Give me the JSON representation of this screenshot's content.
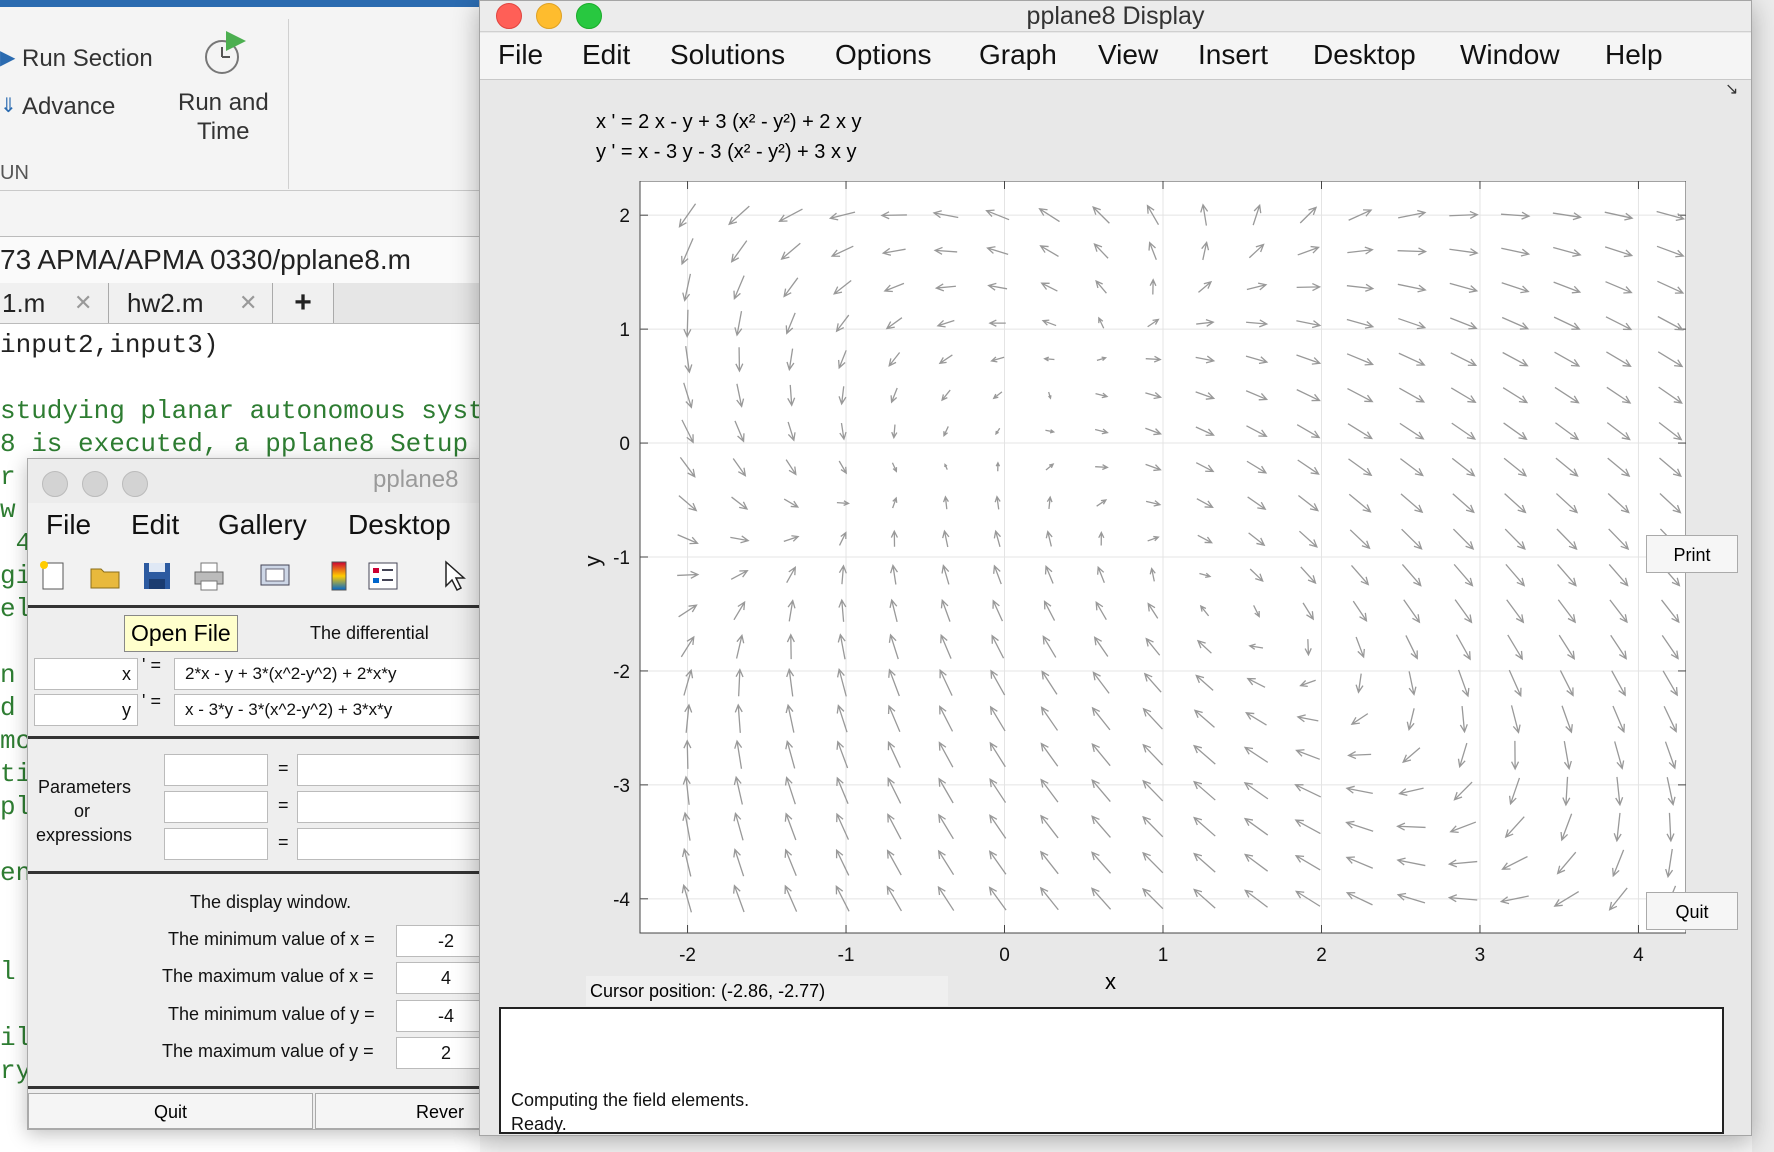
{
  "matlab": {
    "toolstrip": {
      "run_section": "Run Section",
      "advance": "Advance",
      "run_and_time_line1": "Run and",
      "run_and_time_line2": "Time",
      "group_label": "UN"
    },
    "path": "73 APMA/APMA 0330/pplane8.m",
    "tabs": [
      "1.m",
      "hw2.m"
    ],
    "new_tab": "+",
    "code_lines": [
      {
        "text": "input2,input3)",
        "color": "#222222"
      },
      {
        "text": "",
        "color": "#222222"
      },
      {
        "text": "studying planar autonomous syst",
        "color": "#2e7d32"
      },
      {
        "text": "8 is executed, a pplane8 Setup",
        "color": "#2e7d32"
      },
      {
        "text": "r",
        "color": "#2e7d32"
      },
      {
        "text": "w",
        "color": "#2e7d32"
      },
      {
        "text": " 4",
        "color": "#2e7d32"
      },
      {
        "text": "gi",
        "color": "#2e7d32"
      },
      {
        "text": "el",
        "color": "#2e7d32"
      },
      {
        "text": "",
        "color": "#2e7d32"
      },
      {
        "text": "n",
        "color": "#2e7d32"
      },
      {
        "text": "d",
        "color": "#2e7d32"
      },
      {
        "text": "mo",
        "color": "#2e7d32"
      },
      {
        "text": "ti",
        "color": "#2e7d32"
      },
      {
        "text": "pl",
        "color": "#2e7d32"
      },
      {
        "text": "",
        "color": "#2e7d32"
      },
      {
        "text": "en",
        "color": "#2e7d32"
      },
      {
        "text": "",
        "color": "#2e7d32"
      },
      {
        "text": "",
        "color": "#2e7d32"
      },
      {
        "text": "l",
        "color": "#2e7d32"
      },
      {
        "text": "",
        "color": "#2e7d32"
      },
      {
        "text": "il",
        "color": "#2e7d32"
      },
      {
        "text": "ry",
        "color": "#2e7d32"
      }
    ]
  },
  "setup": {
    "title": "pplane8",
    "menu": [
      "File",
      "Edit",
      "Gallery",
      "Desktop"
    ],
    "toolbar_icons": [
      "new-file-icon",
      "open-folder-icon",
      "save-icon",
      "print-icon",
      "print-preview-icon",
      "colorbar-icon",
      "legend-icon",
      "pointer-icon"
    ],
    "tooltip": "Open File",
    "differential_label": "The differential",
    "eq1": {
      "var": "x",
      "prime": "' =",
      "rhs": "2*x - y + 3*(x^2-y^2) + 2*x*y"
    },
    "eq2": {
      "var": "y",
      "prime": "' =",
      "rhs": "x - 3*y - 3*(x^2-y^2) + 3*x*y"
    },
    "parameters_label_1": "Parameters",
    "parameters_label_2": "or",
    "parameters_label_3": "expressions",
    "equals": "=",
    "display_window_label": "The display window.",
    "bounds": [
      {
        "label": "The minimum value of x =",
        "value": "-2"
      },
      {
        "label": "The maximum value of x =",
        "value": "4"
      },
      {
        "label": "The minimum value of y =",
        "value": "-4"
      },
      {
        "label": "The maximum value of y =",
        "value": "2"
      }
    ],
    "quit": "Quit",
    "revert": "Rever"
  },
  "display": {
    "title": "pplane8 Display",
    "menu": [
      "File",
      "Edit",
      "Solutions",
      "Options",
      "Graph",
      "View",
      "Insert",
      "Desktop",
      "Window",
      "Help"
    ],
    "equation1": "x ' = 2 x - y + 3 (x² - y²) + 2 x y",
    "equation2": "y ' = x - 3 y - 3 (x² - y²) + 3 x y",
    "print": "Print",
    "quit": "Quit",
    "cursor_position": "Cursor position:  (-2.86, -2.77)",
    "x_axis_label": "x",
    "y_axis_label": "y",
    "messages": [
      "Computing the field elements.",
      "Ready."
    ]
  },
  "chart_data": {
    "type": "scatter",
    "subtype": "direction-field",
    "xlabel": "x",
    "ylabel": "y",
    "xlim": [
      -2.3,
      4.3
    ],
    "ylim": [
      -4.3,
      2.3
    ],
    "xticks": [
      -2,
      -1,
      0,
      1,
      2,
      3,
      4
    ],
    "yticks": [
      -4,
      -3,
      -2,
      -1,
      0,
      1,
      2
    ],
    "grid": true,
    "field": {
      "dx": "2*x - y + 3*(x^2-y^2) + 2*x*y",
      "dy": "x - 3*y - 3*(x^2-y^2) + 3*x*y",
      "grid_x_count": 20,
      "grid_y_count": 20
    },
    "arrow_color": "#999999"
  }
}
